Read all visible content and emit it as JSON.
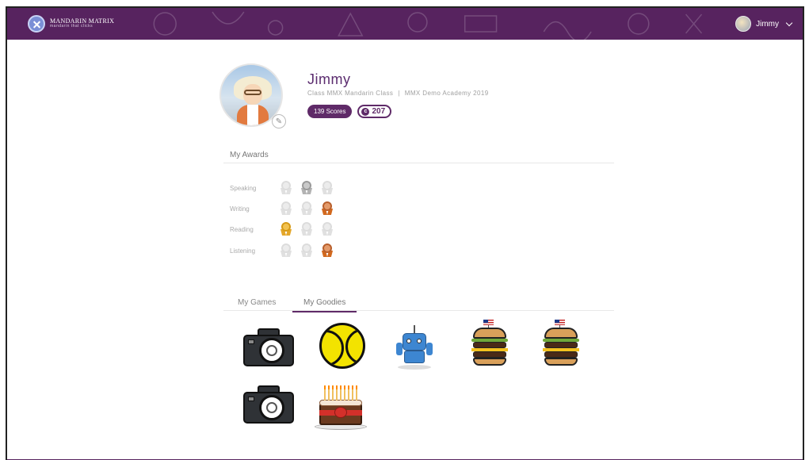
{
  "header": {
    "brand_name": "MANDARIN MATRIX",
    "brand_tagline": "mandarin that clicks",
    "user_name": "Jimmy",
    "colors": {
      "bar": "#57235f"
    }
  },
  "profile": {
    "name": "Jimmy",
    "class_name": "Class MMX Mandarin Class",
    "separator": "|",
    "academy": "MMX Demo Academy 2019",
    "scores_label": "139 Scores",
    "coins": "207"
  },
  "awards": {
    "title": "My Awards",
    "rows": [
      {
        "label": "Speaking",
        "medals": [
          "grey",
          "silver",
          "grey"
        ]
      },
      {
        "label": "Writing",
        "medals": [
          "grey",
          "grey",
          "bronze"
        ]
      },
      {
        "label": "Reading",
        "medals": [
          "gold",
          "grey",
          "grey"
        ]
      },
      {
        "label": "Listening",
        "medals": [
          "grey",
          "grey",
          "bronze"
        ]
      }
    ]
  },
  "tabs": {
    "items": [
      {
        "label": "My Games",
        "active": false
      },
      {
        "label": "My Goodies",
        "active": true
      }
    ]
  },
  "goodies": [
    {
      "icon": "camera-icon"
    },
    {
      "icon": "tennis-ball-icon"
    },
    {
      "icon": "robot-icon"
    },
    {
      "icon": "burger-icon"
    },
    {
      "icon": "burger-icon"
    },
    {
      "icon": "camera-icon"
    },
    {
      "icon": "birthday-cake-icon"
    }
  ]
}
